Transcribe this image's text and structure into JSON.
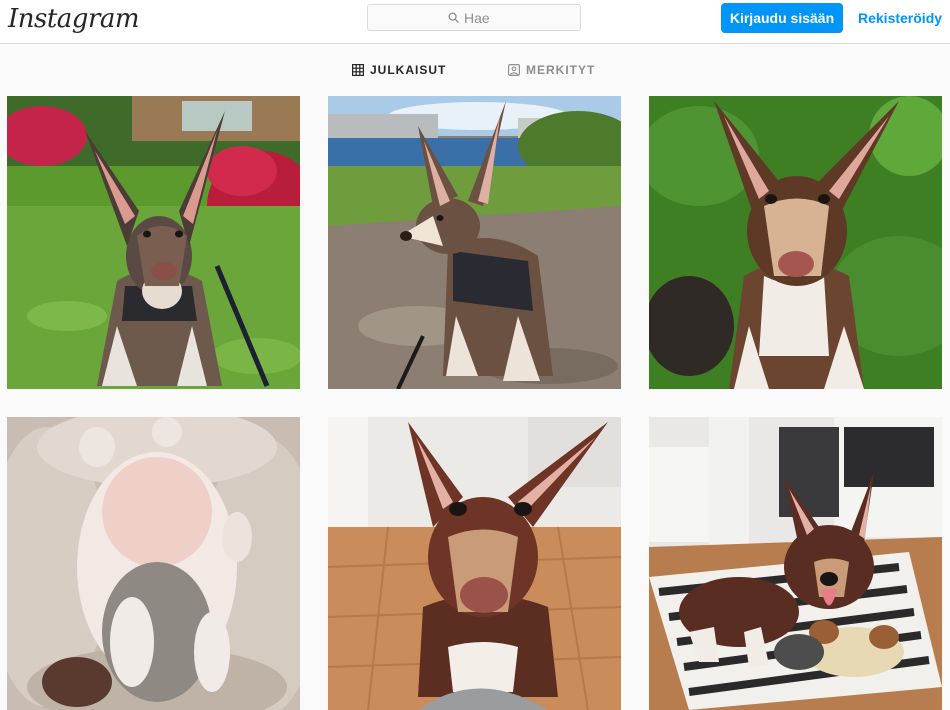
{
  "header": {
    "logo_text": "Instagram",
    "search_placeholder": "Hae",
    "login_label": "Kirjaudu sisään",
    "register_label": "Rekisteröidy"
  },
  "tabs": [
    {
      "label": "JULKAISUT",
      "icon": "grid-icon",
      "active": true
    },
    {
      "label": "MERKITYT",
      "icon": "tagged-icon",
      "active": false
    }
  ],
  "posts": [
    {
      "subject": "puppy-sitting-in-grass-by-red-shrubs"
    },
    {
      "subject": "puppy-on-rock-by-lake"
    },
    {
      "subject": "puppy-sitting-in-grass-looking-up"
    },
    {
      "subject": "puppy-lying-on-back-in-bed"
    },
    {
      "subject": "puppy-closeup-on-parquet-floor"
    },
    {
      "subject": "puppy-on-rug-with-toy"
    }
  ],
  "colors": {
    "accent": "#0095f6",
    "text": "#262626",
    "muted": "#8e8e8e",
    "border": "#dbdbdb",
    "background": "#fafafa"
  }
}
